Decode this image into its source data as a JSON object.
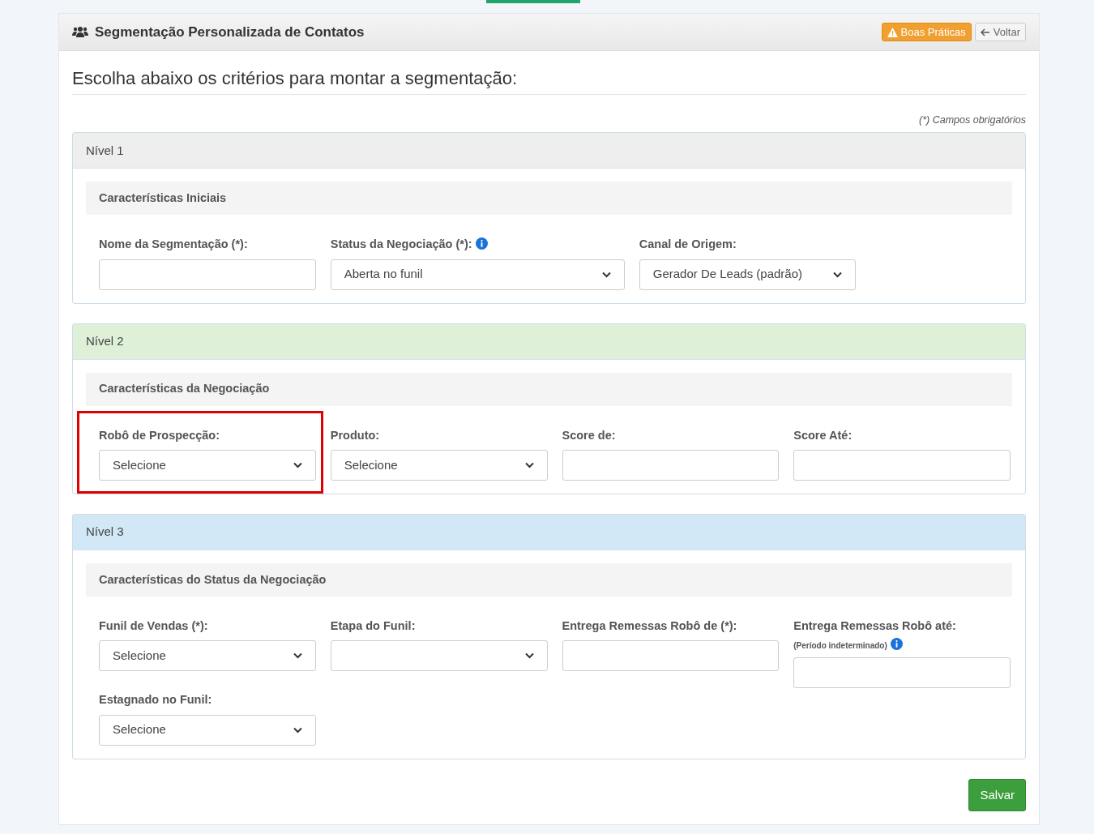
{
  "header": {
    "title": "Segmentação Personalizada de Contatos",
    "buttons": [
      {
        "kind": "warning",
        "label": "Boas Práticas"
      },
      {
        "kind": "back",
        "label": "Voltar"
      }
    ]
  },
  "heading": "Escolha abaixo os critérios para montar a segmentação:",
  "required_note": "(*) Campos obrigatórios",
  "levels": [
    {
      "title": "Nível 1",
      "color": "#eeeeee",
      "section": "Características Iniciais",
      "fields": [
        {
          "label": "Nome da Segmentação (*):",
          "kind": "text",
          "highlighted": false
        },
        {
          "label": "Status da Negociação (*):",
          "info": true,
          "kind": "select",
          "value": "Aberta no funil",
          "highlighted": false
        },
        {
          "label": "Canal de Origem:",
          "kind": "select",
          "value": "Gerador De Leads (padrão)",
          "highlighted": false
        }
      ]
    },
    {
      "title": "Nível 2",
      "color": "#dff0d8",
      "section": "Características da Negociação",
      "fields": [
        {
          "label": "Robô de Prospecção:",
          "kind": "select",
          "value": "Selecione",
          "highlighted": true
        },
        {
          "label": "Produto:",
          "kind": "select",
          "value": "Selecione",
          "highlighted": false
        },
        {
          "label": "Score de:",
          "kind": "text",
          "highlighted": false
        },
        {
          "label": "Score Até:",
          "kind": "text",
          "highlighted": false
        }
      ]
    },
    {
      "title": "Nível 3",
      "color": "#d2e8f6",
      "section": "Características do Status da Negociação",
      "fields": [
        {
          "label": "Funil de Vendas (*):",
          "kind": "select",
          "value": "Selecione",
          "highlighted": false
        },
        {
          "label": "Etapa do Funil:",
          "kind": "select",
          "highlighted": false
        },
        {
          "label": "Entrega Remessas Robô de (*):",
          "kind": "text",
          "highlighted": false
        },
        {
          "label": "Entrega Remessas Robô até:",
          "note": "(Período indeterminado)",
          "info": true,
          "kind": "text",
          "highlighted": false
        },
        {
          "label": "Estagnado no Funil:",
          "kind": "select",
          "value": "Selecione",
          "highlighted": false
        }
      ]
    }
  ],
  "save_button": "Salvar"
}
